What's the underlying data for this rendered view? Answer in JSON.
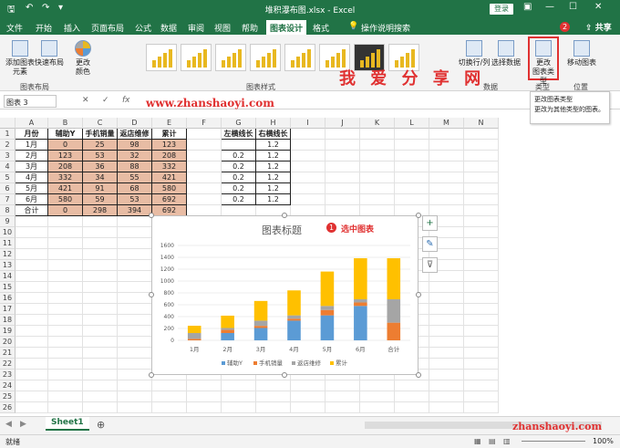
{
  "titlebar": {
    "title": "堆积瀑布图.xlsx - Excel",
    "login": "登录",
    "undo_icon": "undo-icon",
    "redo_icon": "redo-icon"
  },
  "menu": {
    "tabs": [
      "文件",
      "开始",
      "插入",
      "页面布局",
      "公式",
      "数据",
      "审阅",
      "视图",
      "帮助",
      "图表设计",
      "格式"
    ],
    "search": "操作说明搜索",
    "share": "共享",
    "badge2": "2"
  },
  "ribbon": {
    "add_element": "添加图表\n元素",
    "quick_layout": "快速布局",
    "change_color": "更改\n颜色",
    "switch_row_col": "切换行/列",
    "select_data": "选择数据",
    "change_type": "更改\n图表类型",
    "move_chart": "移动图表",
    "group_layout": "图表布局",
    "group_styles": "图表样式",
    "group_data": "数据",
    "group_type": "类型",
    "group_position": "位置"
  },
  "watermark": "我 爱 分 享 网",
  "watermark_url": "www.zhanshaoyi.com",
  "tooltip": {
    "title": "更改图表类型",
    "body": "更改为其他类型的图表。"
  },
  "formula": {
    "name_box": "图表 3",
    "fx": "fx"
  },
  "columns": [
    "A",
    "B",
    "C",
    "D",
    "E",
    "F",
    "G",
    "H",
    "I",
    "J",
    "K",
    "L",
    "M",
    "N"
  ],
  "rows": [
    "1",
    "2",
    "3",
    "4",
    "5",
    "6",
    "7",
    "8",
    "9",
    "10",
    "11",
    "12",
    "13",
    "14",
    "15",
    "16",
    "17",
    "18",
    "19",
    "20",
    "21",
    "22",
    "23",
    "24",
    "25",
    "26"
  ],
  "table": {
    "headers": [
      "月份",
      "辅助Y",
      "手机销量",
      "返店维修",
      "累计"
    ],
    "rows": [
      [
        "1月",
        "0",
        "25",
        "98",
        "123"
      ],
      [
        "2月",
        "123",
        "53",
        "32",
        "208"
      ],
      [
        "3月",
        "208",
        "36",
        "88",
        "332"
      ],
      [
        "4月",
        "332",
        "34",
        "55",
        "421"
      ],
      [
        "5月",
        "421",
        "91",
        "68",
        "580"
      ],
      [
        "6月",
        "580",
        "59",
        "53",
        "692"
      ],
      [
        "合计",
        "0",
        "298",
        "394",
        "692"
      ]
    ]
  },
  "side_table": {
    "headers": [
      "左横线长",
      "右横线长"
    ],
    "rows": [
      [
        "",
        "1.2"
      ],
      [
        "0.2",
        "1.2"
      ],
      [
        "0.2",
        "1.2"
      ],
      [
        "0.2",
        "1.2"
      ],
      [
        "0.2",
        "1.2"
      ],
      [
        "0.2",
        "1.2"
      ]
    ]
  },
  "chart_data": {
    "type": "bar",
    "title": "图表标题",
    "categories": [
      "1月",
      "2月",
      "3月",
      "4月",
      "5月",
      "6月",
      "合计"
    ],
    "series": [
      {
        "name": "辅助Y",
        "values": [
          0,
          123,
          208,
          332,
          421,
          580,
          0
        ],
        "color": "#5b9bd5"
      },
      {
        "name": "手机销量",
        "values": [
          25,
          53,
          36,
          34,
          91,
          59,
          298
        ],
        "color": "#ed7d31"
      },
      {
        "name": "返店维修",
        "values": [
          98,
          32,
          88,
          55,
          68,
          53,
          394
        ],
        "color": "#a5a5a5"
      },
      {
        "name": "累计",
        "values": [
          123,
          208,
          332,
          421,
          580,
          692,
          692
        ],
        "color": "#ffc000"
      }
    ],
    "yticks": [
      "0",
      "200",
      "400",
      "600",
      "800",
      "1000",
      "1200",
      "1400",
      "1600"
    ],
    "ylim": [
      0,
      1600
    ],
    "legend": "bottom",
    "grid": true
  },
  "chart_ui": {
    "badge1": "1",
    "select_note": "选中图表",
    "plus_icon": "plus-icon",
    "brush_icon": "brush-icon",
    "filter_icon": "filter-icon"
  },
  "sheet": {
    "tab": "Sheet1",
    "status": "就绪",
    "zoom": "100%"
  },
  "watermark_url2": "zhanshaoyi.com"
}
